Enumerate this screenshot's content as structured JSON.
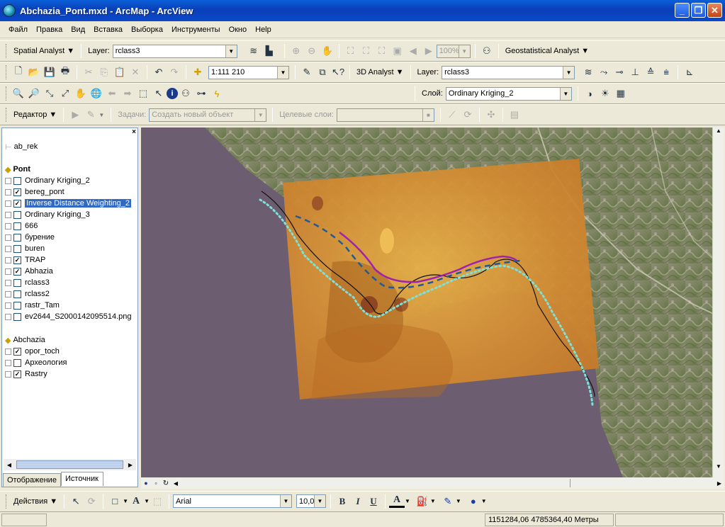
{
  "window": {
    "title": "Abchazia_Pont.mxd - ArcMap - ArcView",
    "minimize": "_",
    "maximize": "❐",
    "close": "✕"
  },
  "menu": [
    "Файл",
    "Правка",
    "Вид",
    "Вставка",
    "Выборка",
    "Инструменты",
    "Окно",
    "Help"
  ],
  "toolbar1": {
    "spatial_analyst": "Spatial Analyst",
    "layer_label": "Layer:",
    "layer_value": "rclass3",
    "zoom_value": "100%",
    "geostat": "Geostatistical Analyst"
  },
  "toolbar2": {
    "scale_value": "1:111 210",
    "analyst3d": "3D Analyst",
    "layer_label": "Layer:",
    "layer_value": "rclass3"
  },
  "toolbar3": {
    "layer_label": "Слой:",
    "layer_value": "Ordinary Kriging_2"
  },
  "editor": {
    "editor_label": "Редактор",
    "task_label": "Задачи:",
    "task_value": "Создать новый объект",
    "target_label": "Целевые слои:"
  },
  "toc": {
    "top_layer": "ab_rek",
    "group1": "Pont",
    "group1_layers": [
      {
        "name": "Ordinary Kriging_2",
        "checked": false
      },
      {
        "name": "bereg_pont",
        "checked": true
      },
      {
        "name": "Inverse Distance Weighting_2",
        "checked": true
      },
      {
        "name": "Ordinary Kriging_3",
        "checked": false
      },
      {
        "name": "666",
        "checked": false
      },
      {
        "name": "бурение",
        "checked": false
      },
      {
        "name": "buren",
        "checked": false
      },
      {
        "name": "TRAP",
        "checked": true
      },
      {
        "name": "Abhazia",
        "checked": true
      },
      {
        "name": "rclass3",
        "checked": false
      },
      {
        "name": "rclass2",
        "checked": false
      },
      {
        "name": "rastr_Tam",
        "checked": false
      },
      {
        "name": "ev2644_S2000142095514.png",
        "checked": false
      }
    ],
    "group2": "Abchazia",
    "group2_layers": [
      {
        "name": "opor_toch",
        "checked": true
      },
      {
        "name": "Археология",
        "checked": false
      },
      {
        "name": "Rastry",
        "checked": true
      }
    ],
    "tab_display": "Отображение",
    "tab_source": "Источник"
  },
  "draw": {
    "actions": "Действия",
    "font": "Arial",
    "size": "10,00",
    "bold": "B",
    "italic": "I",
    "underline": "U",
    "font_color_glyph": "A"
  },
  "status": {
    "coords": "1151284,06  4785364,40 Метры"
  },
  "colors": {
    "selection": "#316ac5",
    "titlebar": "#0a4fd0",
    "magenta_line": "#a020b0",
    "blue_dash": "#1f5a9a",
    "cyan_dots": "#7fe0d8"
  }
}
